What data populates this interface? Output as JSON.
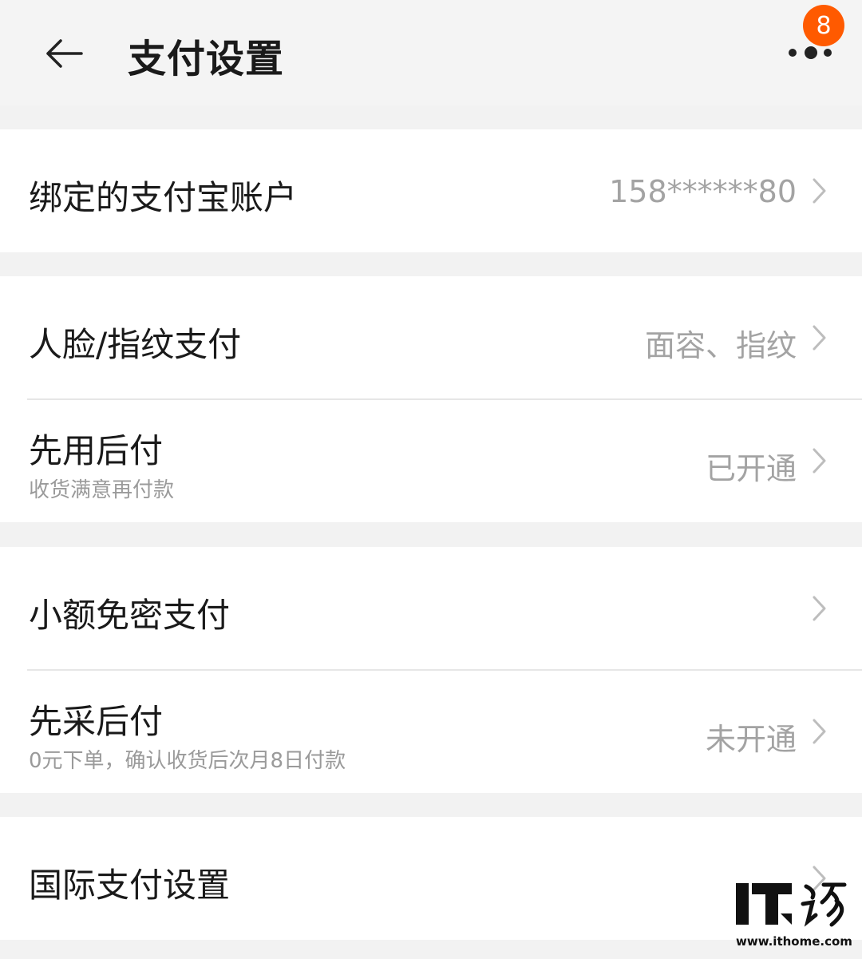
{
  "header": {
    "title": "支付设置",
    "back_icon": "arrow-left-icon",
    "more_icon": "more-dots-icon",
    "badge_count": "8",
    "badge_color": "#ff5a00"
  },
  "rows": [
    {
      "label": "绑定的支付宝账户",
      "value": "158******80"
    },
    {
      "label": "人脸/指纹支付",
      "value": "面容、指纹"
    },
    {
      "label": "先用后付",
      "sub": "收货满意再付款",
      "value": "已开通"
    },
    {
      "label": "小额免密支付",
      "value": ""
    },
    {
      "label": "先采后付",
      "sub": "0元下单，确认收货后次月8日付款",
      "value": "未开通"
    },
    {
      "label": "国际支付设置",
      "value": ""
    }
  ],
  "watermark": {
    "url": "www.ithome.com"
  }
}
